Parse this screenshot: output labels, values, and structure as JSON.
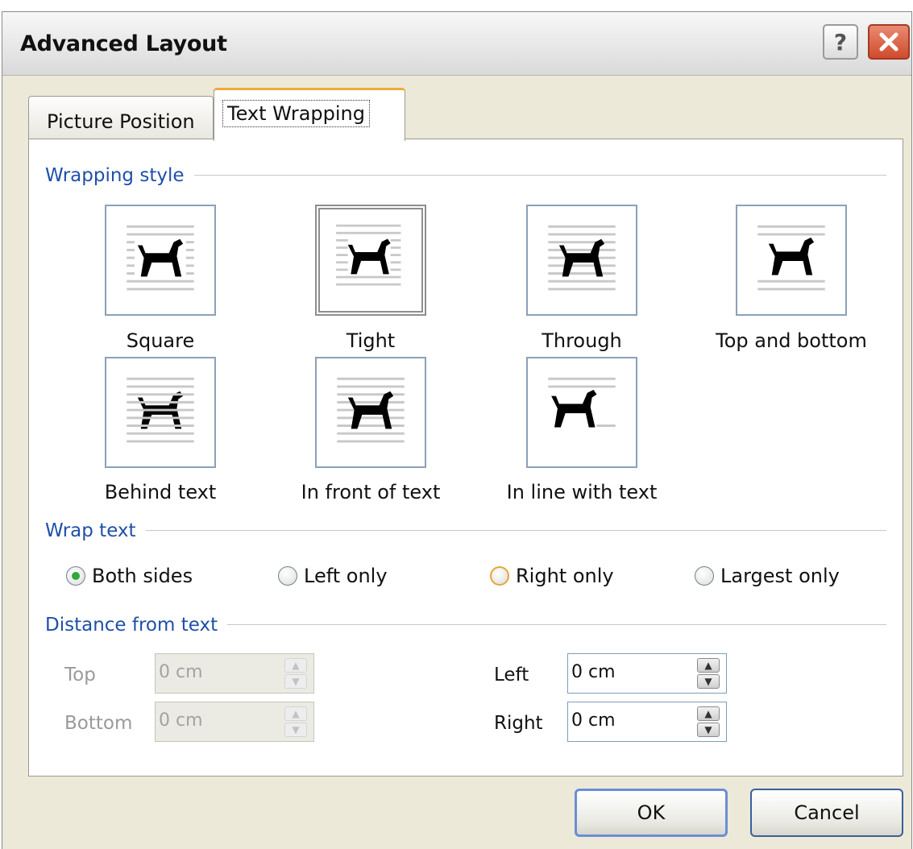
{
  "window": {
    "title": "Advanced Layout",
    "help_label": "?"
  },
  "tabs": [
    {
      "label": "Picture Position",
      "active": false
    },
    {
      "label": "Text Wrapping",
      "active": true
    }
  ],
  "wrapping_style": {
    "title": "Wrapping style",
    "options": [
      {
        "label": "Square",
        "mnemonic": "q",
        "selected": false
      },
      {
        "label": "Tight",
        "mnemonic": "T",
        "selected": true
      },
      {
        "label": "Through",
        "mnemonic": "h",
        "selected": false
      },
      {
        "label": "Top and bottom",
        "mnemonic": "o",
        "selected": false
      },
      {
        "label": "Behind text",
        "mnemonic": "B",
        "selected": false
      },
      {
        "label": "In front of text",
        "mnemonic": "f",
        "selected": false
      },
      {
        "label": "In line with text",
        "mnemonic": "I",
        "selected": false
      }
    ]
  },
  "wrap_text": {
    "title": "Wrap text",
    "options": [
      {
        "label": "Both sides",
        "mnemonic": "s",
        "checked": true
      },
      {
        "label": "Left only",
        "mnemonic": "L",
        "checked": false
      },
      {
        "label": "Right only",
        "mnemonic": "R",
        "checked": false
      },
      {
        "label": "Largest only",
        "mnemonic": "a",
        "checked": false
      }
    ]
  },
  "distance": {
    "title": "Distance from text",
    "top": {
      "label": "Top",
      "value": "0 cm",
      "enabled": false
    },
    "bottom": {
      "label": "Bottom",
      "value": "0 cm",
      "enabled": false
    },
    "left": {
      "label": "Left",
      "value": "0 cm",
      "enabled": true
    },
    "right": {
      "label": "Right",
      "value": "0 cm",
      "enabled": true
    }
  },
  "buttons": {
    "ok": "OK",
    "cancel": "Cancel"
  },
  "colors": {
    "group_title": "#1f4fa8",
    "tab_highlight": "#f2a93b",
    "radio_checked": "#31a93a",
    "close_button": "#cf4b2c"
  }
}
